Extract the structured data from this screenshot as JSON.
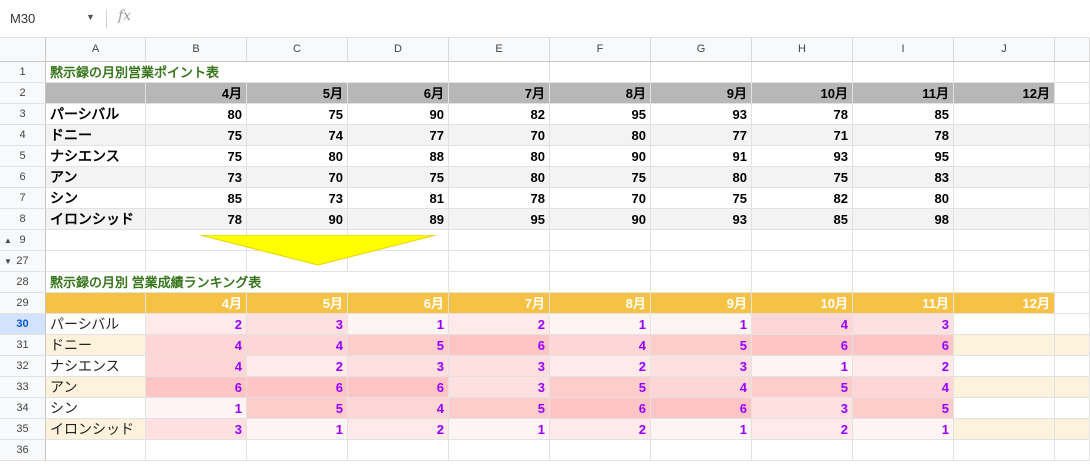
{
  "namebox": {
    "cell_ref": "M30"
  },
  "formula_bar": {
    "fx": "fx",
    "value": ""
  },
  "columns": [
    "A",
    "B",
    "C",
    "D",
    "E",
    "F",
    "G",
    "H",
    "I",
    "J"
  ],
  "table1": {
    "title": "黙示録の月別営業ポイント表",
    "months": [
      "4月",
      "5月",
      "6月",
      "7月",
      "8月",
      "9月",
      "10月",
      "11月",
      "12月"
    ],
    "rows": [
      {
        "name": "パーシバル",
        "values": [
          80,
          75,
          90,
          82,
          95,
          93,
          78,
          85,
          ""
        ]
      },
      {
        "name": "ドニー",
        "values": [
          75,
          74,
          77,
          70,
          80,
          77,
          71,
          78,
          ""
        ]
      },
      {
        "name": "ナシエンス",
        "values": [
          75,
          80,
          88,
          80,
          90,
          91,
          93,
          95,
          ""
        ]
      },
      {
        "name": "アン",
        "values": [
          73,
          70,
          75,
          80,
          75,
          80,
          75,
          83,
          ""
        ]
      },
      {
        "name": "シン",
        "values": [
          85,
          73,
          81,
          78,
          70,
          75,
          82,
          80,
          ""
        ]
      },
      {
        "name": "イロンシッド",
        "values": [
          78,
          90,
          89,
          95,
          90,
          93,
          85,
          98,
          ""
        ]
      }
    ]
  },
  "table2": {
    "title": "黙示録の月別 営業成績ランキング表",
    "months": [
      "4月",
      "5月",
      "6月",
      "7月",
      "8月",
      "9月",
      "10月",
      "11月",
      "12月"
    ],
    "rows": [
      {
        "name": "パーシバル",
        "values": [
          2,
          3,
          1,
          2,
          1,
          1,
          4,
          3,
          ""
        ]
      },
      {
        "name": "ドニー",
        "values": [
          4,
          4,
          5,
          6,
          4,
          5,
          6,
          6,
          ""
        ]
      },
      {
        "name": "ナシエンス",
        "values": [
          4,
          2,
          3,
          3,
          2,
          3,
          1,
          2,
          ""
        ]
      },
      {
        "name": "アン",
        "values": [
          6,
          6,
          6,
          3,
          5,
          4,
          5,
          4,
          ""
        ]
      },
      {
        "name": "シン",
        "values": [
          1,
          5,
          4,
          5,
          6,
          6,
          3,
          5,
          ""
        ]
      },
      {
        "name": "イロンシッド",
        "values": [
          3,
          1,
          2,
          1,
          2,
          1,
          2,
          1,
          ""
        ]
      }
    ]
  },
  "row_numbers": {
    "r1": "1",
    "r2": "2",
    "r3": "3",
    "r4": "4",
    "r5": "5",
    "r6": "6",
    "r7": "7",
    "r8": "8",
    "r9": "9",
    "r27": "27",
    "r28": "28",
    "r29": "29",
    "r30": "30",
    "r31": "31",
    "r32": "32",
    "r33": "33",
    "r34": "34",
    "r35": "35",
    "r36": "36"
  },
  "colors": {
    "title_green": "#38761d",
    "header_gray": "#b7b7b7",
    "header_gold": "#f6c244",
    "rank_purple": "#9900ff",
    "arrow_yellow": "#ffff00"
  }
}
